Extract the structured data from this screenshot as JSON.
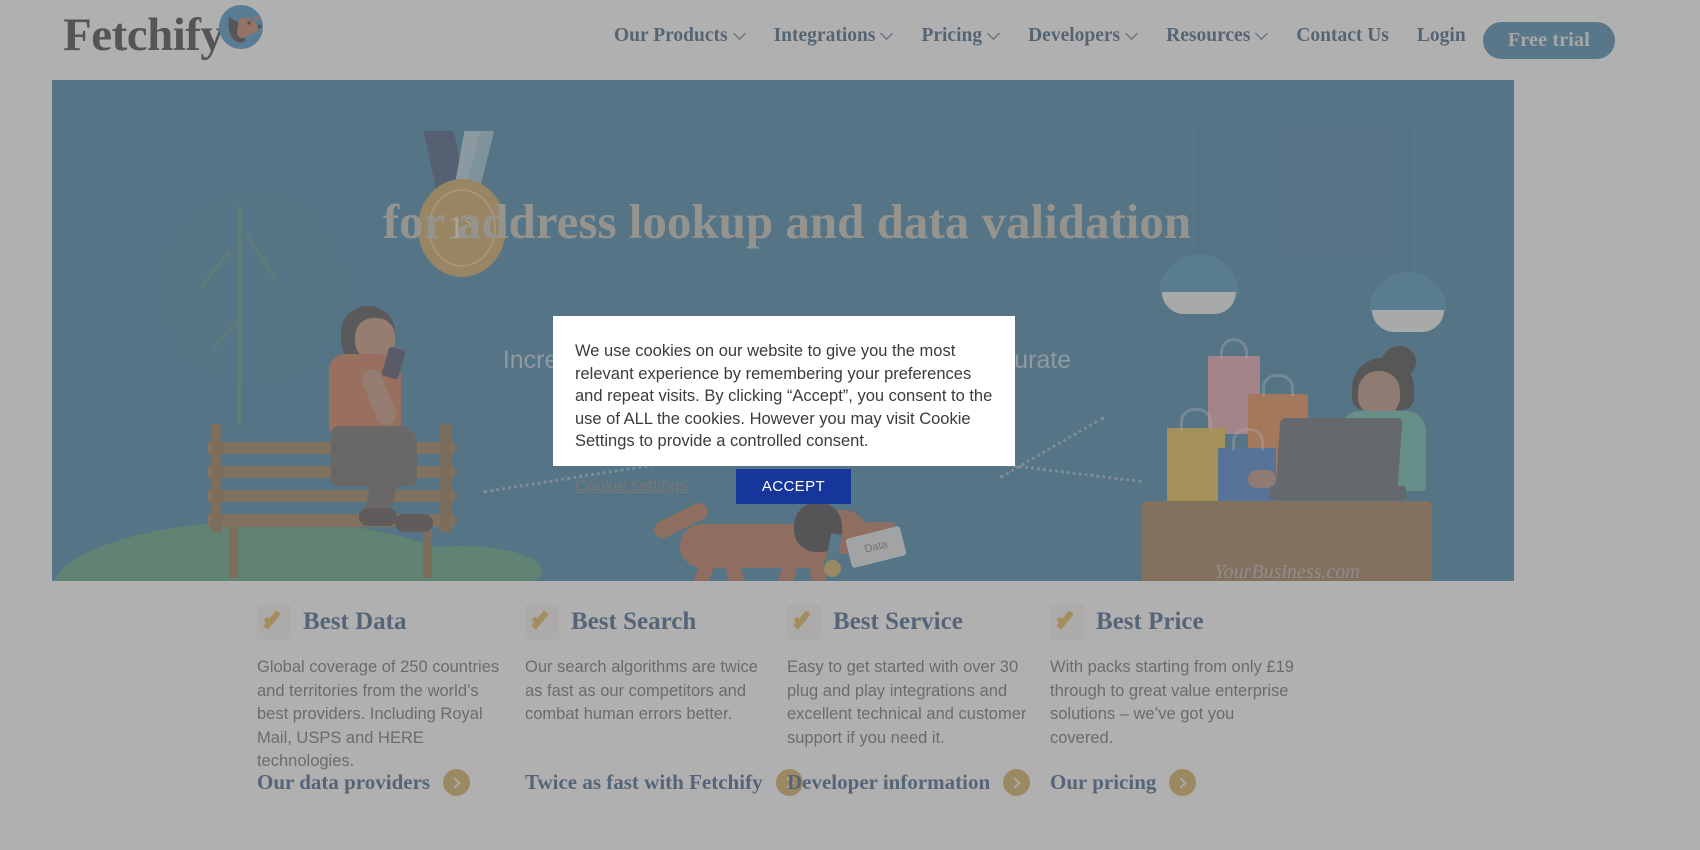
{
  "header": {
    "logo_text": "Fetchify",
    "logo_icon": "dog-head-icon",
    "nav": [
      {
        "label": "Our Products",
        "has_dropdown": true
      },
      {
        "label": "Integrations",
        "has_dropdown": true
      },
      {
        "label": "Pricing",
        "has_dropdown": true
      },
      {
        "label": "Developers",
        "has_dropdown": true
      },
      {
        "label": "Resources",
        "has_dropdown": true
      },
      {
        "label": "Contact Us",
        "has_dropdown": false
      },
      {
        "label": "Login",
        "has_dropdown": false
      }
    ],
    "cta_label": "Free trial"
  },
  "hero": {
    "medal_number": "1",
    "medal_suffix": "st",
    "heading": "for address lookup and data validation",
    "subheading": "Increase conversion with the fastest, most accurate customer data capture",
    "dog_envelope_label": "Data",
    "business_url": "YourBusiness.com"
  },
  "cookie_banner": {
    "text": "We use cookies on our website to give you the most relevant experience by remembering your preferences and repeat visits. By clicking “Accept”, you consent to the use of ALL the cookies. However you may visit Cookie Settings to provide a controlled consent.",
    "settings_link": "Cookie settings",
    "accept_label": "ACCEPT"
  },
  "features": [
    {
      "icon": "check-icon",
      "title": "Best Data",
      "body": "Global coverage of 250 countries and territories from the world’s best providers. Including Royal Mail, USPS and HERE technologies.",
      "link": "Our data providers"
    },
    {
      "icon": "check-icon",
      "title": "Best Search",
      "body": "Our search algorithms are twice as fast as our competitors and combat human errors better.",
      "link": "Twice as fast with Fetchify"
    },
    {
      "icon": "check-icon",
      "title": "Best Service",
      "body": "Easy to get started with over 30 plug and play integrations and excellent technical and customer support if you need it.",
      "link": "Developer information"
    },
    {
      "icon": "check-icon",
      "title": "Best Price",
      "body": "With packs starting from only £19 through to great value enterprise solutions – we’ve got you covered.",
      "link": "Our pricing"
    }
  ],
  "colors": {
    "hero_background": "#12618f",
    "nav_text": "#11385f",
    "cta_background": "#1a6a99",
    "accept_background": "#17369c",
    "accent_gold": "#c99a33",
    "heading_navy": "#12396b"
  }
}
